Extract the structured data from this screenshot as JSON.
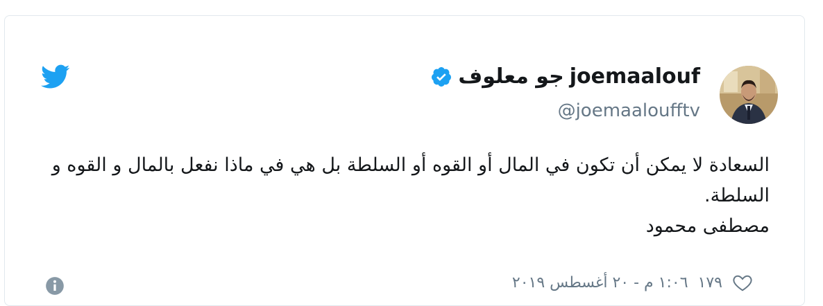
{
  "account": {
    "display_name": "جو معلوف",
    "username": "joemaalouf",
    "handle": "@joemaaloufftv",
    "verified": true
  },
  "tweet": {
    "line1": "السعادة لا يمكن أن تكون في المال أو القوه أو السلطة بل هي في ماذا نفعل بالمال و القوه و",
    "line2": "السلطة.",
    "line3": "مصطفى محمود"
  },
  "footer": {
    "like_count": "١٧٩",
    "timestamp": "١:٠٦ م - ٢٠ أغسطس ٢٠١٩"
  },
  "icons": {
    "bird": "twitter-bird-icon",
    "verified": "verified-badge-icon",
    "heart": "heart-icon",
    "info": "info-icon"
  },
  "colors": {
    "twitter_blue": "#1da1f2",
    "text_primary": "#14171a",
    "text_secondary": "#657786"
  }
}
